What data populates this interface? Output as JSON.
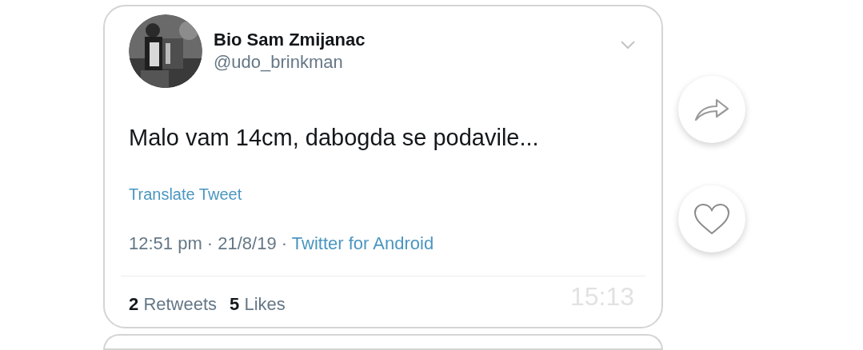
{
  "tweet": {
    "name": "Bio Sam Zmijanac",
    "handle": "@udo_brinkman",
    "text": "Malo vam 14cm, dabogda se podavile...",
    "translate": "Translate Tweet",
    "time": "12:51 pm · 21/8/19 · ",
    "source": "Twitter for Android",
    "stats": [
      {
        "count": "2",
        "label": "Retweets"
      },
      {
        "count": "5",
        "label": "Likes"
      }
    ]
  },
  "message_time": "15:13",
  "actions": [
    {
      "kind": "share"
    },
    {
      "kind": "like"
    }
  ]
}
